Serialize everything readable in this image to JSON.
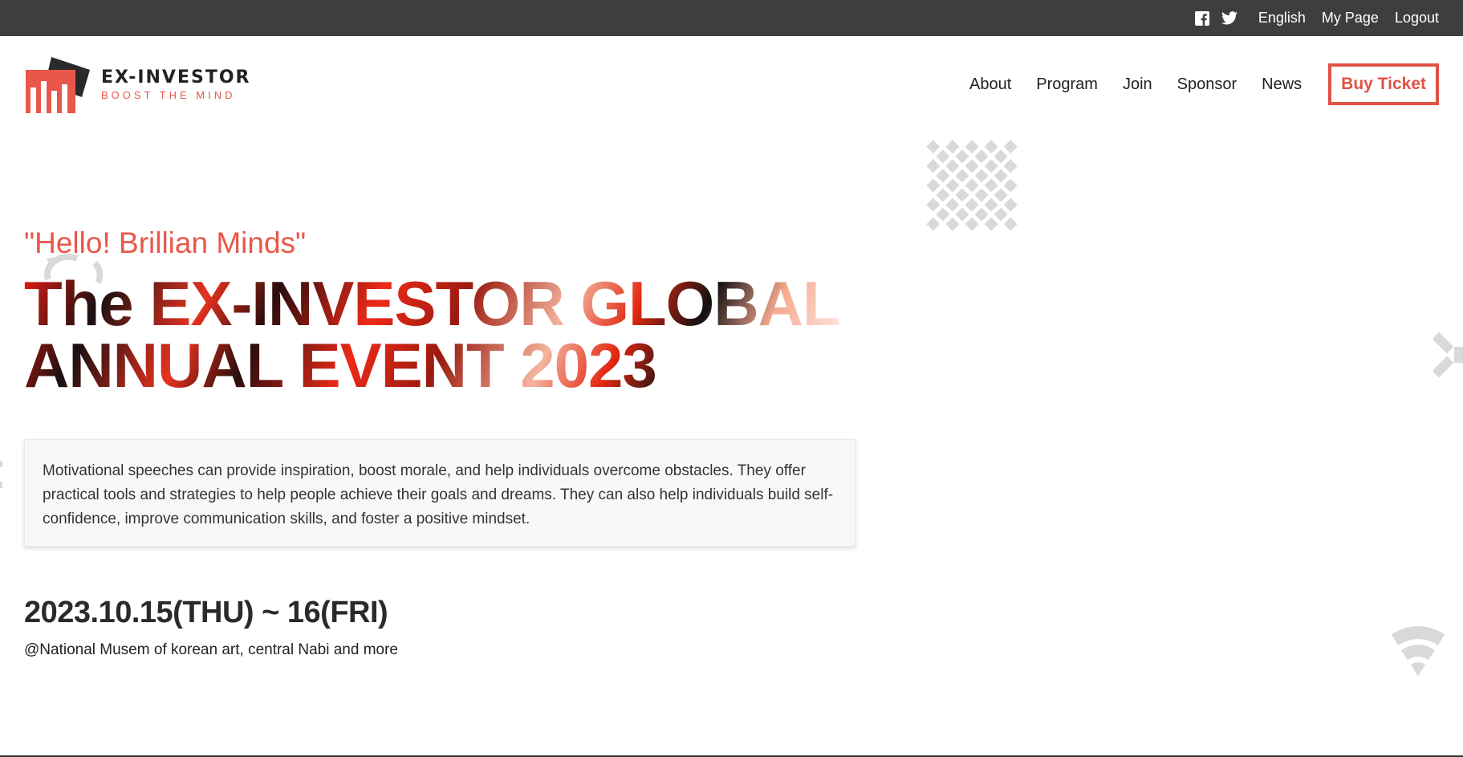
{
  "topbar": {
    "social": [
      "facebook-icon",
      "twitter-icon"
    ],
    "links": [
      "English",
      "My Page",
      "Logout"
    ]
  },
  "logo": {
    "name": "EX-INVESTOR",
    "tagline": "BOOST THE MIND"
  },
  "nav": {
    "items": [
      "About",
      "Program",
      "Join",
      "Sponsor",
      "News"
    ],
    "ticket": "Buy Ticket"
  },
  "hero": {
    "quote": "\"Hello! Brillian Minds\"",
    "title_line1": "The EX-INVESTOR GLOBAL",
    "title_line2": "ANNUAL EVENT 2023",
    "description": "Motivational speeches can provide inspiration, boost morale, and help individuals overcome obstacles. They offer practical tools and strategies to help people achieve their goals and dreams. They can also help individuals build self-confidence, improve communication skills, and foster a positive mindset.",
    "date": "2023.10.15(THU) ~ 16(FRI)",
    "venue": "@National Musem of korean art, central Nabi and more"
  },
  "colors": {
    "accent": "#e8574a",
    "topbar": "#3e3e3e",
    "decor": "#d9d9d9"
  }
}
